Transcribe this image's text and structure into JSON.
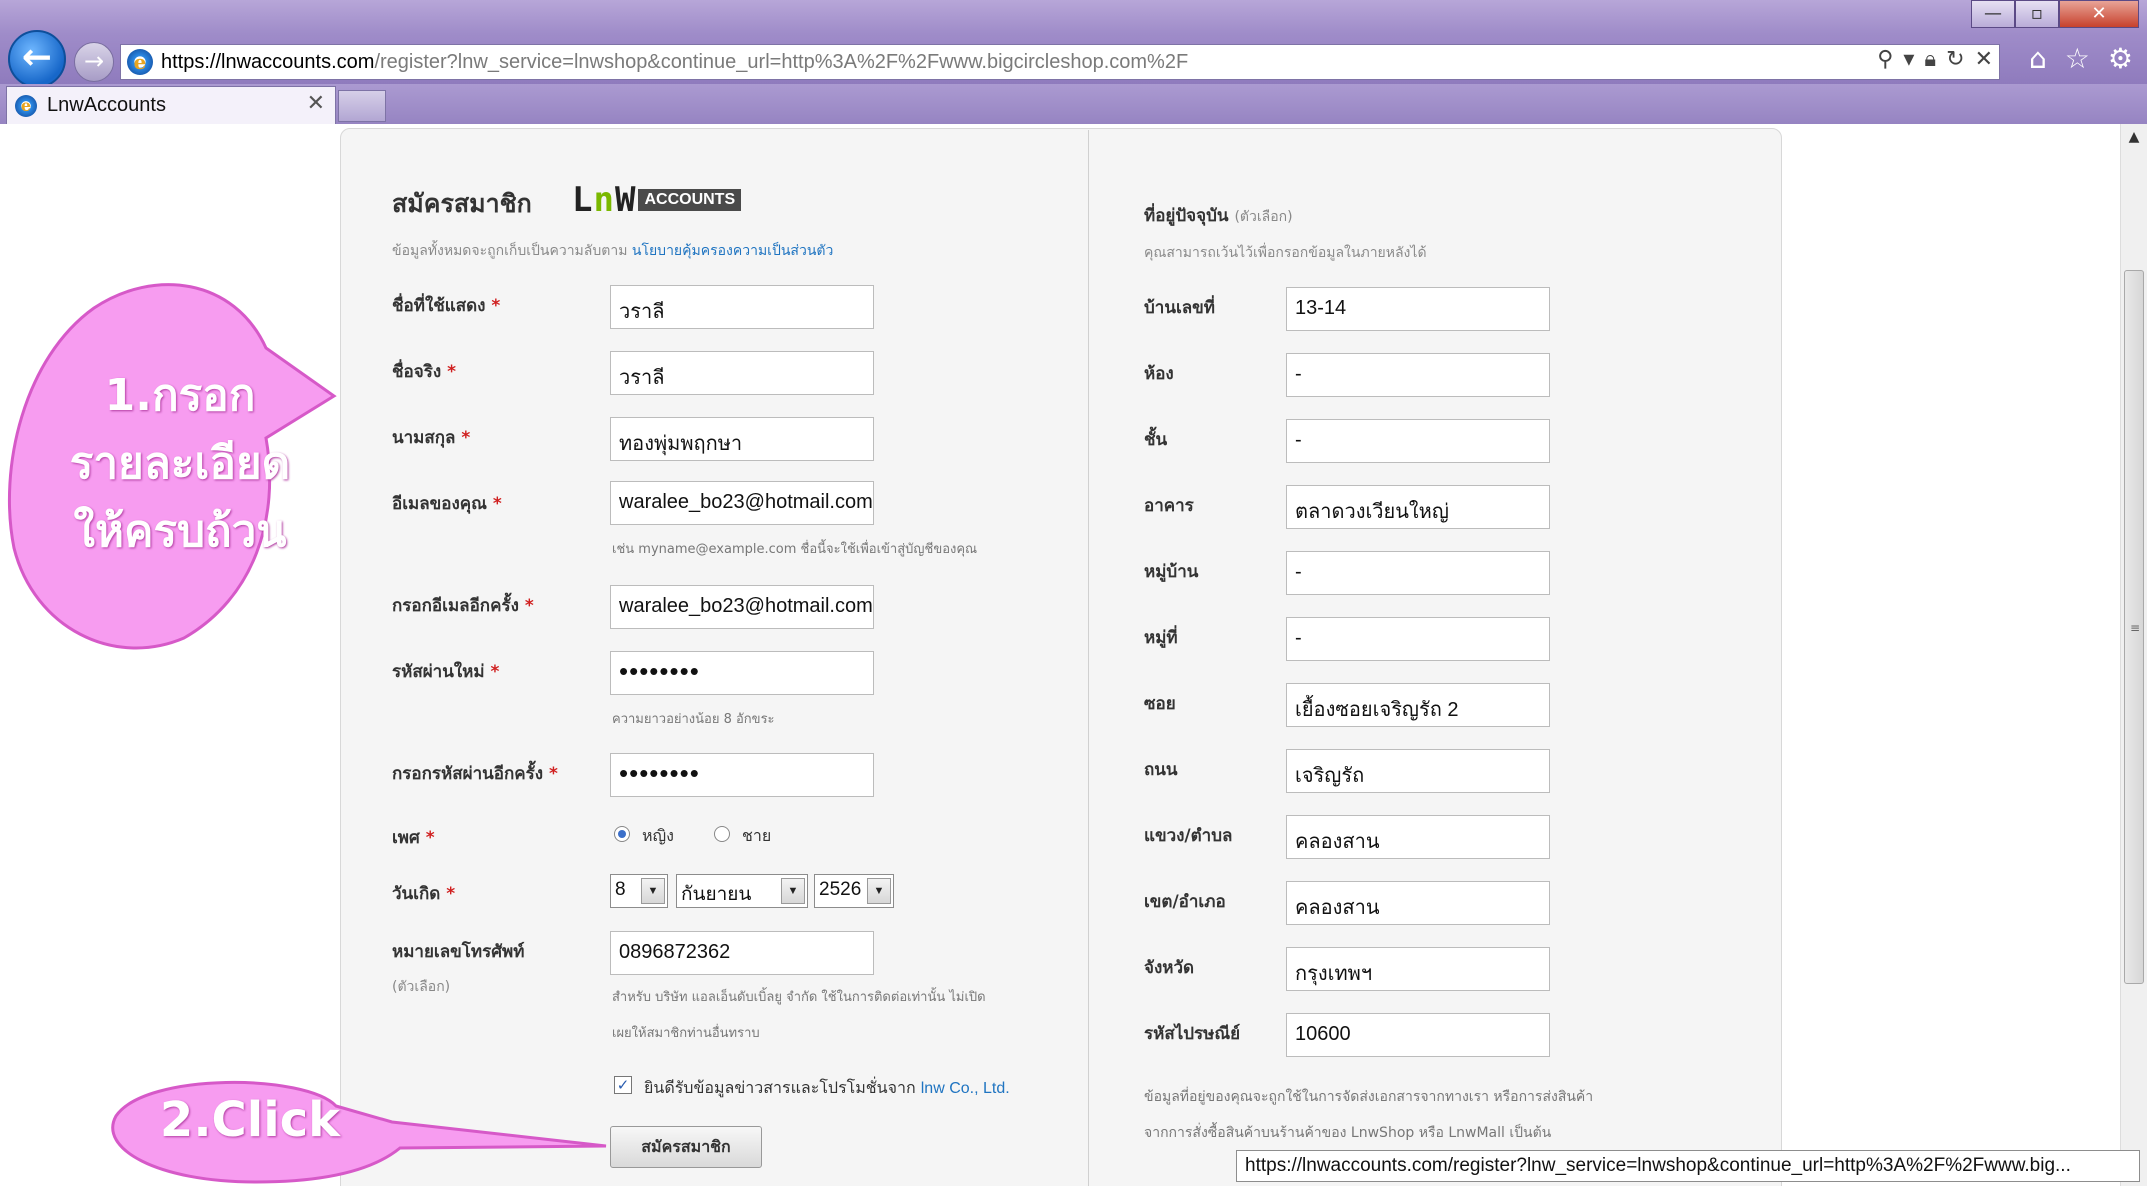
{
  "browser": {
    "window_buttons": {
      "minimize": "—",
      "maximize": "▫",
      "close": "✕"
    },
    "url_host": "https://lnwaccounts.com",
    "url_rest": "/register?lnw_service=lnwshop&continue_url=http%3A%2F%2Fwww.bigcircleshop.com%2F",
    "tab_title": "LnwAccounts",
    "tab_close": "✕",
    "status_url": "https://lnwaccounts.com/register?lnw_service=lnwshop&continue_url=http%3A%2F%2Fwww.big..."
  },
  "form": {
    "title": "สมัครสมาชิก",
    "logo_text": "Lnw",
    "logo_badge": "ACCOUNTS",
    "privacy_text": "ข้อมูลทั้งหมดจะถูกเก็บเป็นความลับตาม",
    "privacy_link": "นโยบายคุ้มครองความเป็นส่วนตัว",
    "required_mark": "*",
    "fields": {
      "display_name": {
        "label": "ชื่อที่ใช้แสดง",
        "value": "วราลี"
      },
      "first_name": {
        "label": "ชื่อจริง",
        "value": "วราลี"
      },
      "last_name": {
        "label": "นามสกุล",
        "value": "ทองพุ่มพฤกษา"
      },
      "email": {
        "label": "อีเมลของคุณ",
        "value": "waralee_bo23@hotmail.com",
        "hint": "เช่น myname@example.com ชื่อนี้จะใช้เพื่อเข้าสู่บัญชีของคุณ"
      },
      "email_confirm": {
        "label": "กรอกอีเมลอีกครั้ง",
        "value": "waralee_bo23@hotmail.com"
      },
      "password": {
        "label": "รหัสผ่านใหม่",
        "value": "••••••••",
        "hint": "ความยาวอย่างน้อย 8 อักขระ"
      },
      "password_confirm": {
        "label": "กรอกรหัสผ่านอีกครั้ง",
        "value": "••••••••"
      },
      "gender": {
        "label": "เพศ",
        "female": "หญิง",
        "male": "ชาย"
      },
      "birthday": {
        "label": "วันเกิด",
        "day": "8",
        "month": "กันยายน",
        "year": "2526"
      },
      "phone": {
        "label": "หมายเลขโทรศัพท์",
        "optional": "(ตัวเลือก)",
        "value": "0896872362",
        "hint1": "สำหรับ บริษัท แอลเอ็นดับเบิ้ลยู จำกัด ใช้ในการติดต่อเท่านั้น ไม่เปิด",
        "hint2": "เผยให้สมาชิกท่านอื่นทราบ"
      }
    },
    "newsletter_text": "ยินดีรับข้อมูลข่าวสารและโปรโมชั่นจาก",
    "newsletter_company": "lnw Co., Ltd.",
    "checkmark": "✓",
    "submit_label": "สมัครสมาชิก"
  },
  "address": {
    "heading": "ที่อยู่ปัจจุบัน",
    "heading_optional": "(ตัวเลือก)",
    "subtext": "คุณสามารถเว้นไว้เพื่อกรอกข้อมูลในภายหลังได้",
    "fields": [
      {
        "label": "บ้านเลขที่",
        "value": "13-14"
      },
      {
        "label": "ห้อง",
        "value": "-"
      },
      {
        "label": "ชั้น",
        "value": "-"
      },
      {
        "label": "อาคาร",
        "value": "ตลาดวงเวียนใหญ่"
      },
      {
        "label": "หมู่บ้าน",
        "value": "-"
      },
      {
        "label": "หมู่ที่",
        "value": "-"
      },
      {
        "label": "ซอย",
        "value": "เยื้องซอยเจริญรัถ 2"
      },
      {
        "label": "ถนน",
        "value": "เจริญรัถ"
      },
      {
        "label": "แขวง/ตำบล",
        "value": "คลองสาน"
      },
      {
        "label": "เขต/อำเภอ",
        "value": "คลองสาน"
      },
      {
        "label": "จังหวัด",
        "value": "กรุงเทพฯ"
      },
      {
        "label": "รหัสไปรษณีย์",
        "value": "10600"
      }
    ],
    "note1": "ข้อมูลที่อยู่ของคุณจะถูกใช้ในการจัดส่งเอกสารจากทางเรา หรือการส่งสินค้า",
    "note2": "จากการสั่งซื้อสินค้าบนร้านค้าของ LnwShop หรือ LnwMall เป็นต้น"
  },
  "callouts": {
    "step1_num": "1.",
    "step1_line1": "กรอก",
    "step1_line2": "รายละเอียด",
    "step1_line3": "ให้ครบถ้วน",
    "step2": "2.Click"
  },
  "colors": {
    "accent": "#1f74c1",
    "required": "#d02020",
    "callout": "#f79cf0",
    "callout_border": "#d659c8"
  }
}
